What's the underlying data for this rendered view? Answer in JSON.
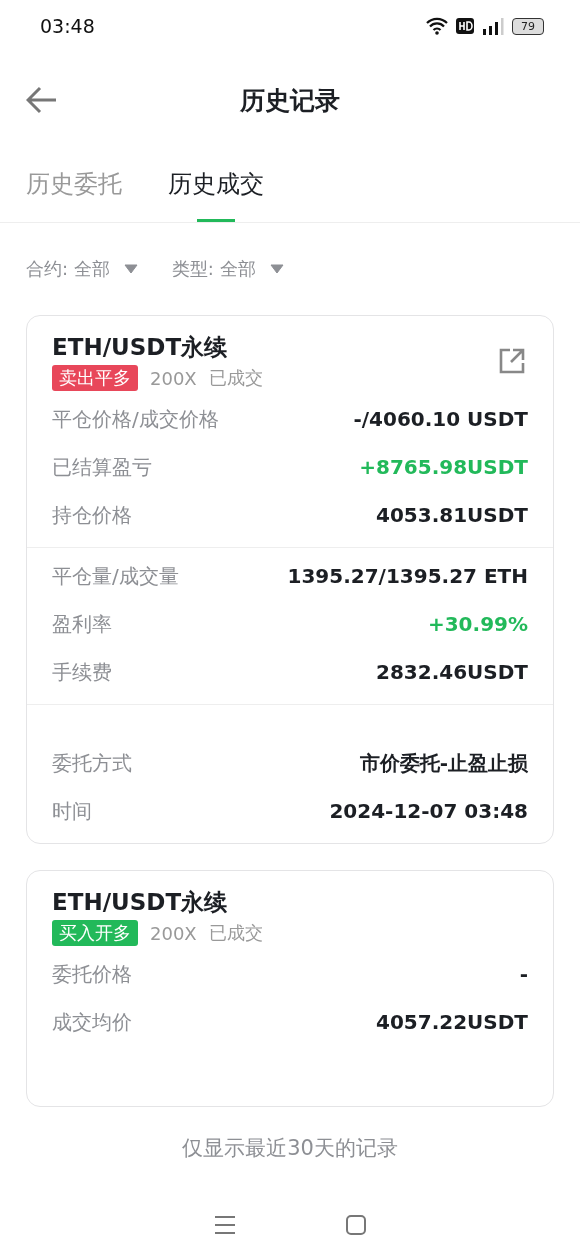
{
  "status_bar": {
    "time": "03:48",
    "battery": "79"
  },
  "header": {
    "title": "历史记录"
  },
  "tabs": [
    {
      "label": "历史委托",
      "selected": false
    },
    {
      "label": "历史成交",
      "selected": true
    }
  ],
  "filters": [
    {
      "label": "合约: 全部"
    },
    {
      "label": "类型: 全部"
    }
  ],
  "orders": [
    {
      "pair": "ETH/USDT永续",
      "side": {
        "label": "卖出平多",
        "color": "#e8475a"
      },
      "leverage": "200X",
      "status": "已成交",
      "share": true,
      "sections": [
        [
          {
            "label": "平仓价格/成交价格",
            "value": "-/4060.10 USDT",
            "kind": "plain"
          },
          {
            "label": "已结算盈亏",
            "value": "+8765.98USDT",
            "kind": "gain"
          },
          {
            "label": "持仓价格",
            "value": "4053.81USDT",
            "kind": "plain"
          }
        ],
        [
          {
            "label": "平仓量/成交量",
            "value": "1395.27/1395.27 ETH",
            "kind": "plain"
          },
          {
            "label": "盈利率",
            "value": "+30.99%",
            "kind": "gain"
          },
          {
            "label": "手续费",
            "value": "2832.46USDT",
            "kind": "plain"
          }
        ],
        [
          {
            "label": "委托方式",
            "value": "市价委托-止盈止损",
            "kind": "plain"
          },
          {
            "label": "时间",
            "value": "2024-12-07 03:48",
            "kind": "plain"
          }
        ]
      ]
    },
    {
      "pair": "ETH/USDT永续",
      "side": {
        "label": "买入开多",
        "color": "#22b95a"
      },
      "leverage": "200X",
      "status": "已成交",
      "share": false,
      "sections": [
        [
          {
            "label": "委托价格",
            "value": "-",
            "kind": "plain"
          },
          {
            "label": "成交均价",
            "value": "4057.22USDT",
            "kind": "plain"
          }
        ]
      ]
    }
  ],
  "footer": {
    "note": "仅显示最近30天的记录"
  }
}
